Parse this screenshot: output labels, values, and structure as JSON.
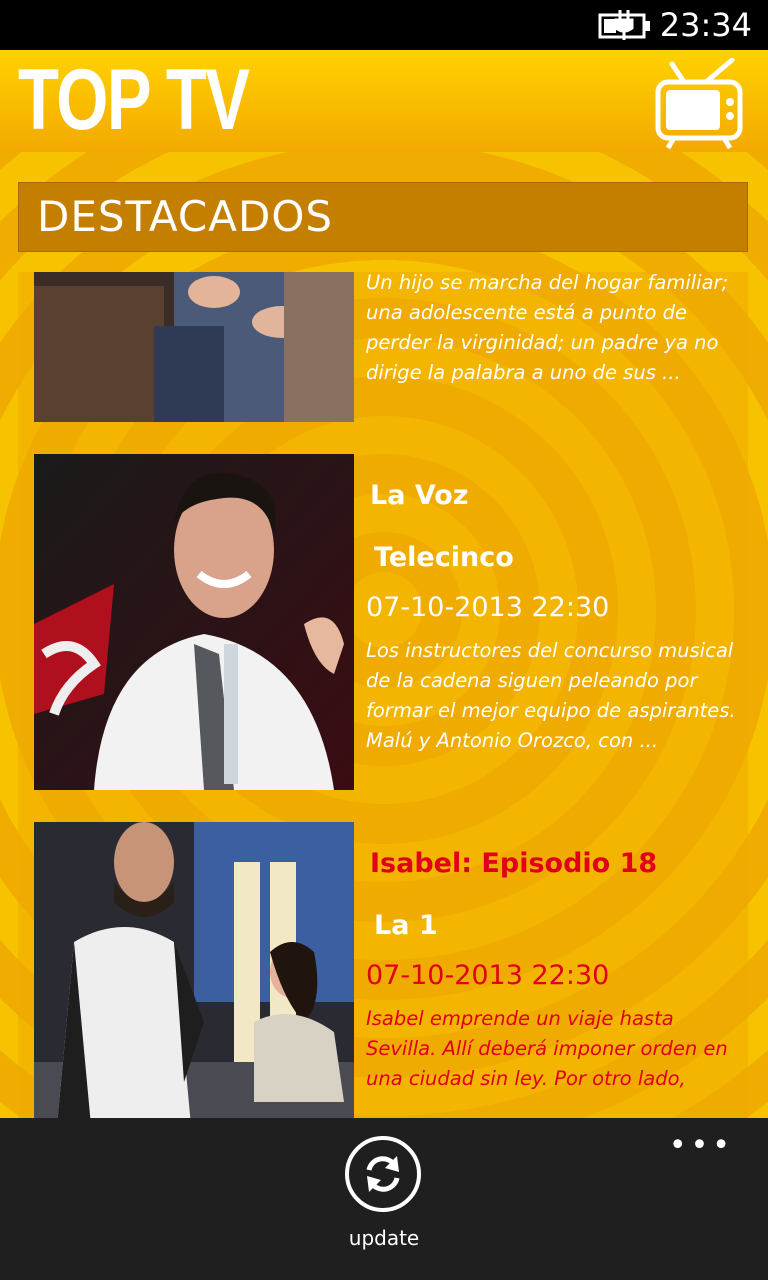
{
  "status_bar": {
    "time": "23:34",
    "battery_icon": "battery-charging-icon"
  },
  "header": {
    "title": "TOP TV",
    "icon": "tv-icon"
  },
  "section": {
    "title": "DESTACADOS"
  },
  "items": [
    {
      "title": "",
      "channel": "",
      "date": "",
      "description": "Un hijo se marcha del hogar familiar; una adolescente está a punto de perder la virginidad; un padre ya no dirige la palabra a uno de sus ..."
    },
    {
      "title": "La Voz",
      "channel": "Telecinco",
      "date": "07-10-2013 22:30",
      "description": "Los instructores del concurso musical de la cadena siguen peleando por formar el mejor equipo de aspirantes. Malú y Antonio Orozco, con ..."
    },
    {
      "title": "Isabel: Episodio 18",
      "channel": "La 1",
      "date": "07-10-2013 22:30",
      "description": "Isabel emprende un viaje hasta Sevilla. Allí deberá imponer orden en una ciudad sin ley. Por otro lado,"
    }
  ],
  "app_bar": {
    "update_label": "update",
    "more": "•••",
    "update_icon": "refresh-icon"
  },
  "colors": {
    "accent": "#f5b800",
    "section": "#c57f00",
    "highlight": "#e0001a"
  }
}
